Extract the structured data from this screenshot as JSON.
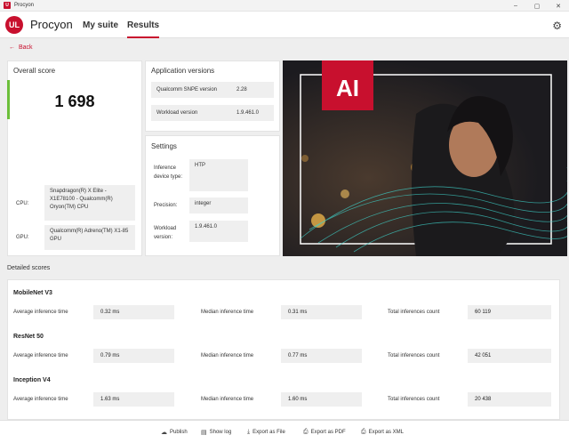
{
  "window": {
    "title": "Procyon",
    "icon": "ul-app-icon"
  },
  "header": {
    "logo": "UL",
    "brand": "Procyon",
    "tabs": [
      {
        "label": "My suite",
        "active": false
      },
      {
        "label": "Results",
        "active": true
      }
    ],
    "settings_icon": "gear-icon"
  },
  "nav": {
    "back_label": "Back"
  },
  "overall": {
    "title": "Overall score",
    "score": "1 698",
    "cpu_label": "CPU:",
    "cpu_value": "Snapdragon(R) X Elite - X1E78100 - Qualcomm(R) Oryon(TM) CPU",
    "gpu_label": "GPU:",
    "gpu_value": "Qualcomm(R) Adreno(TM) X1-85 GPU"
  },
  "app_versions": {
    "title": "Application versions",
    "rows": [
      {
        "label": "Qualcomm SNPE version",
        "value": "2.28"
      },
      {
        "label": "Workload version",
        "value": "1.9.461.0"
      }
    ]
  },
  "settings": {
    "title": "Settings",
    "rows": [
      {
        "label": "Inference device type:",
        "value": "HTP"
      },
      {
        "label": "Precision:",
        "value": "integer"
      },
      {
        "label": "Workload version:",
        "value": "1.9.461.0"
      }
    ]
  },
  "hero": {
    "logo_text": "AI"
  },
  "detailed": {
    "title": "Detailed scores",
    "col_labels": [
      "Average inference time",
      "Median inference time",
      "Total inferences count"
    ],
    "groups": [
      {
        "name": "MobileNet V3",
        "avg": "0.32 ms",
        "median": "0.31 ms",
        "total": "60 119"
      },
      {
        "name": "ResNet 50",
        "avg": "0.79 ms",
        "median": "0.77 ms",
        "total": "42 051"
      },
      {
        "name": "Inception V4",
        "avg": "1.63 ms",
        "median": "1.60 ms",
        "total": "20 438"
      }
    ]
  },
  "footer": {
    "buttons": [
      {
        "label": "Publish",
        "icon": "cloud-upload-icon"
      },
      {
        "label": "Show log",
        "icon": "log-icon"
      },
      {
        "label": "Export as File",
        "icon": "download-icon"
      },
      {
        "label": "Export as PDF",
        "icon": "pdf-icon"
      },
      {
        "label": "Export as XML",
        "icon": "xml-icon"
      }
    ]
  },
  "colors": {
    "accent": "#c8102e",
    "score_bar": "#6cbf3a",
    "value_bg": "#efefef"
  }
}
